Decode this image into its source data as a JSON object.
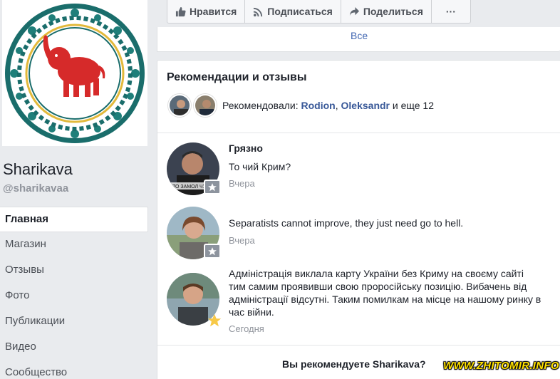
{
  "page": {
    "name": "Sharikava",
    "handle": "@sharikavaa",
    "logo_icon": "elephant-mandala-icon"
  },
  "nav": [
    {
      "label": "Главная",
      "active": true
    },
    {
      "label": "Магазин"
    },
    {
      "label": "Отзывы"
    },
    {
      "label": "Фото"
    },
    {
      "label": "Публикации"
    },
    {
      "label": "Видео"
    },
    {
      "label": "Сообщество"
    }
  ],
  "actions": {
    "like": "Нравится",
    "subscribe": "Подписаться",
    "share": "Поделиться",
    "more": "···"
  },
  "top_card": {
    "see_all": "Все"
  },
  "reviews": {
    "title": "Рекомендации и отзывы",
    "recommended_prefix": "Рекомендовали: ",
    "recommender_1": "Rodion",
    "separator": ", ",
    "recommender_2": "Oleksandr",
    "recommended_suffix": " и еще 12",
    "items": [
      {
        "author": "Грязно",
        "text": "То чий Крим?",
        "time": "Вчера",
        "badge": "star-icon"
      },
      {
        "author": "",
        "text": "Separatists cannot improve, they just need go to hell.",
        "time": "Вчера",
        "badge": "star-icon"
      },
      {
        "author": "",
        "text": "Адміністрація виклала карту України без Криму на своєму сайті тим самим проявивши свою проросійську позицію. Вибачень від адміністрації відсутні. Таким помилкам на місце на нашому ринку в час війни.",
        "time": "Сегодня",
        "badge": "gold-star-icon"
      }
    ],
    "question": "Вы рекомендуете Sharikava?"
  },
  "watermark": "WWW.ZHITOMIR.INFO",
  "colors": {
    "link": "#385898",
    "accent": "#4267b2",
    "elephant": "#d62a2a",
    "mandala": "#1f7f7a",
    "gold_star": "#f7c948"
  }
}
